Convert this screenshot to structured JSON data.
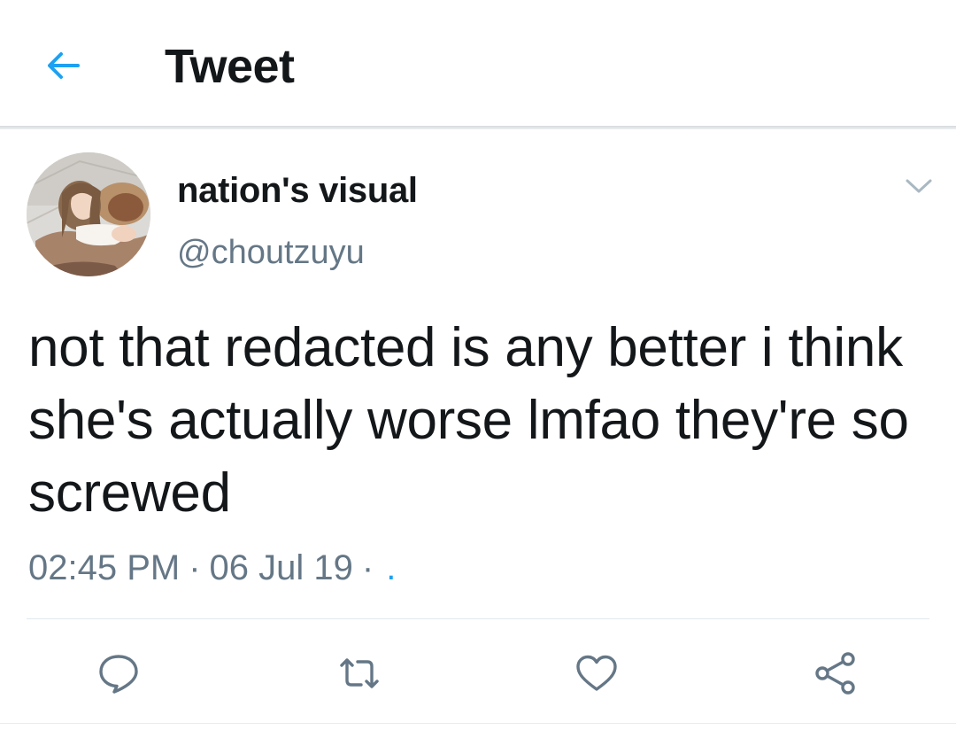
{
  "header": {
    "title": "Tweet",
    "back_icon": "arrow-left-icon"
  },
  "tweet": {
    "display_name": "nation's visual",
    "handle": "@choutzuyu",
    "text": "not that redacted is any better i think she's actually worse lmfao they're so screwed",
    "time": "02:45 PM",
    "date": "06 Jul 19",
    "separator": "·",
    "app_link": "."
  },
  "actions": {
    "reply_icon": "comment-icon",
    "retweet_icon": "retweet-icon",
    "like_icon": "heart-icon",
    "share_icon": "share-icon"
  },
  "colors": {
    "accent": "#1da1f2",
    "text_primary": "#14171a",
    "text_secondary": "#657786",
    "icon_gray": "#657786",
    "divider": "#e1e8ed"
  }
}
